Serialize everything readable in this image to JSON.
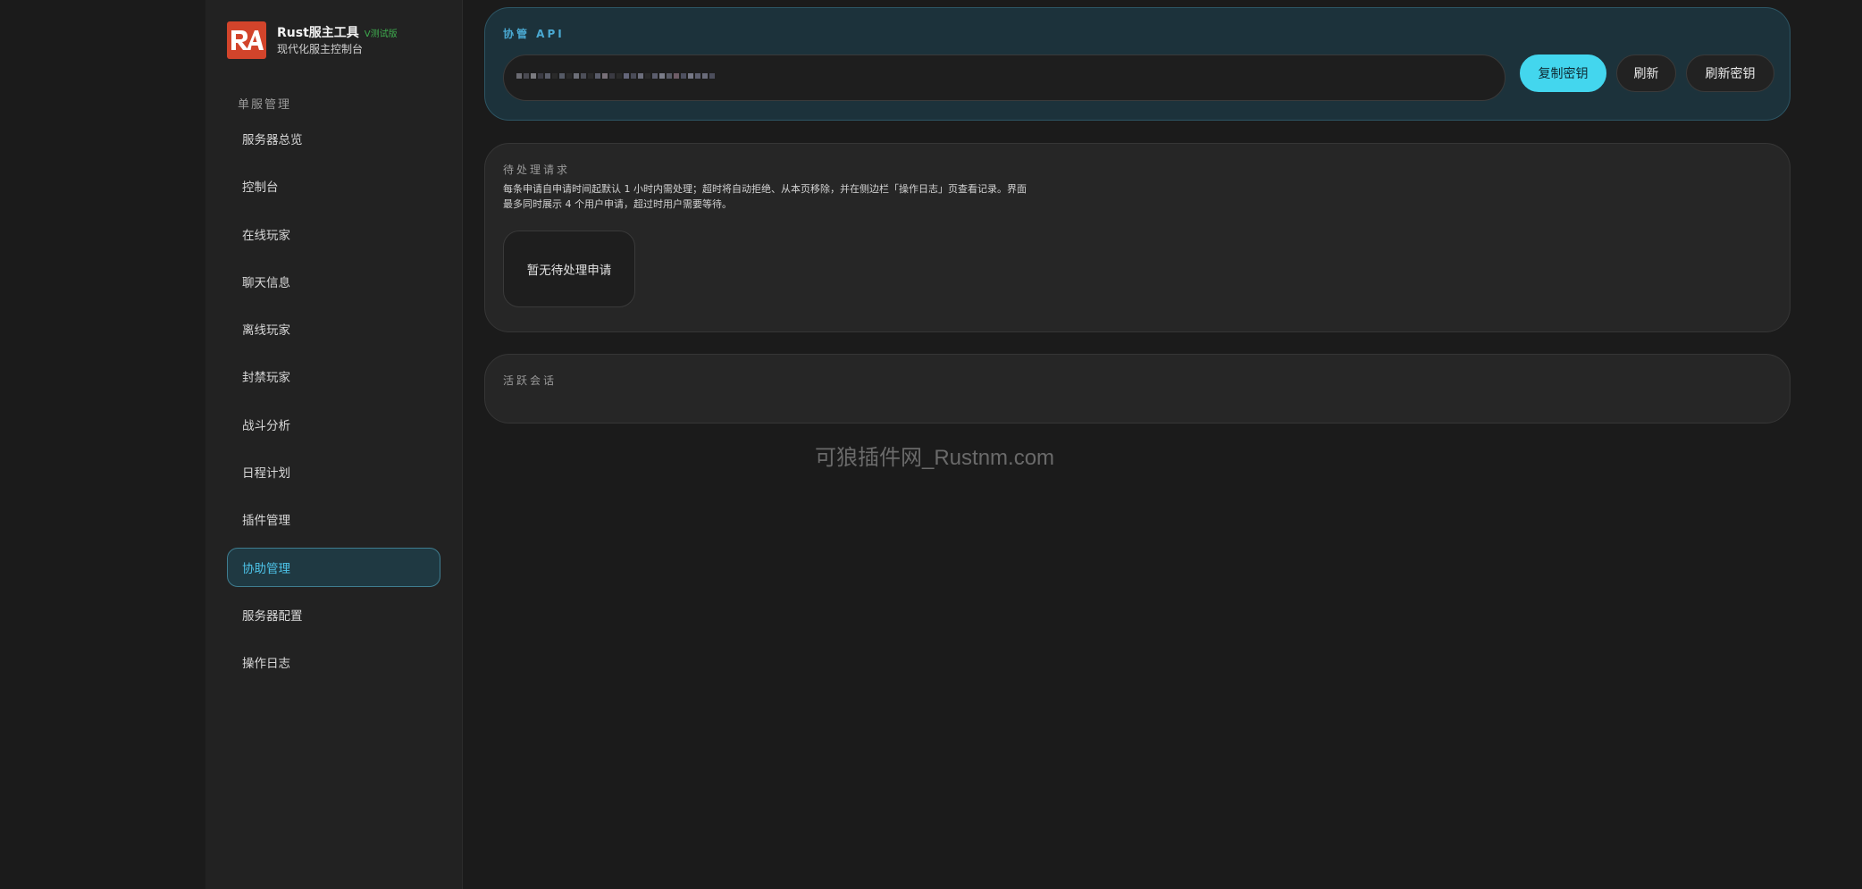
{
  "brand": {
    "logo_text": "RA",
    "title": "Rust服主工具",
    "badge": "V测试版",
    "subtitle": "现代化服主控制台"
  },
  "sidebar": {
    "section_title": "单服管理",
    "items": [
      {
        "label": "服务器总览",
        "active": false
      },
      {
        "label": "控制台",
        "active": false
      },
      {
        "label": "在线玩家",
        "active": false
      },
      {
        "label": "聊天信息",
        "active": false
      },
      {
        "label": "离线玩家",
        "active": false
      },
      {
        "label": "封禁玩家",
        "active": false
      },
      {
        "label": "战斗分析",
        "active": false
      },
      {
        "label": "日程计划",
        "active": false
      },
      {
        "label": "插件管理",
        "active": false
      },
      {
        "label": "协助管理",
        "active": true
      },
      {
        "label": "服务器配置",
        "active": false
      },
      {
        "label": "操作日志",
        "active": false
      }
    ]
  },
  "api_panel": {
    "title": "协管 API",
    "key_masked": true,
    "buttons": {
      "copy": "复制密钥",
      "refresh": "刷新",
      "rotate": "刷新密钥"
    }
  },
  "pending_panel": {
    "title": "待处理请求",
    "description": "每条申请自申请时间起默认 1 小时内需处理；超时将自动拒绝、从本页移除，并在侧边栏「操作日志」页查看记录。界面最多同时展示 4 个用户申请，超过时用户需要等待。",
    "empty_text": "暂无待处理申请"
  },
  "sessions_panel": {
    "title": "活跃会话"
  },
  "watermark": "可狼插件网_Rustnm.com",
  "colors": {
    "background": "#1b1b1b",
    "sidebar": "#222222",
    "accent": "#43d6ee",
    "active_nav_text": "#4dc3e8",
    "logo": "#d2442b",
    "badge": "#3fae4f"
  }
}
